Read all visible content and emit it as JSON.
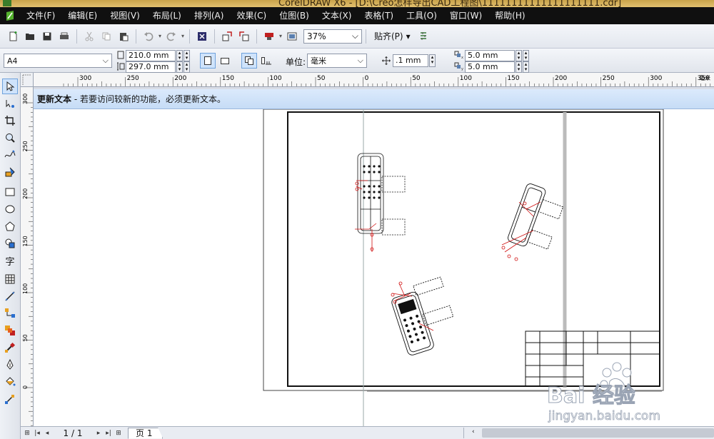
{
  "window": {
    "title": "CorelDRAW X6 - [D:\\Creo怎样导出CAD工程图\\11111111111111111111.cdr]"
  },
  "menu": [
    {
      "label": "文件(F)"
    },
    {
      "label": "编辑(E)"
    },
    {
      "label": "视图(V)"
    },
    {
      "label": "布局(L)"
    },
    {
      "label": "排列(A)"
    },
    {
      "label": "效果(C)"
    },
    {
      "label": "位图(B)"
    },
    {
      "label": "文本(X)"
    },
    {
      "label": "表格(T)"
    },
    {
      "label": "工具(O)"
    },
    {
      "label": "窗口(W)"
    },
    {
      "label": "帮助(H)"
    }
  ],
  "toolbar": {
    "zoom_value": "37%",
    "snap_label": "贴齐(P)"
  },
  "propbar": {
    "page_size": "A4",
    "width": "210.0 mm",
    "height": "297.0 mm",
    "units_label": "单位:",
    "units_value": "毫米",
    "nudge": ".1 mm",
    "dup_x": "5.0 mm",
    "dup_y": "5.0 mm"
  },
  "ruler": {
    "h_ticks": [
      "300",
      "250",
      "200",
      "150",
      "100",
      "50",
      "0",
      "50",
      "100",
      "150",
      "200",
      "250",
      "300",
      "350"
    ],
    "v_ticks": [
      "300",
      "250",
      "200",
      "150",
      "100",
      "50",
      "0"
    ],
    "unit": "毫米"
  },
  "notification": {
    "title": "更新文本",
    "message": " - 若要访问较新的功能，必须更新文本。"
  },
  "tools": [
    {
      "name": "pick"
    },
    {
      "name": "shape"
    },
    {
      "name": "crop"
    },
    {
      "name": "zoom"
    },
    {
      "name": "freehand"
    },
    {
      "name": "smart-fill"
    },
    {
      "name": "rectangle"
    },
    {
      "name": "ellipse"
    },
    {
      "name": "polygon"
    },
    {
      "name": "basic-shapes"
    },
    {
      "name": "text",
      "glyph": "字"
    },
    {
      "name": "table"
    },
    {
      "name": "dimension"
    },
    {
      "name": "connector"
    },
    {
      "name": "blend"
    },
    {
      "name": "eyedropper"
    },
    {
      "name": "outline"
    },
    {
      "name": "fill"
    },
    {
      "name": "interactive-fill"
    }
  ],
  "statusbar": {
    "page_counter": "1 / 1",
    "page_tab": "页 1"
  },
  "drawing": {
    "title_block_cols": 7,
    "title_block_rows": 5
  },
  "colors": {
    "menubar_bg": "#101010",
    "canvas_bg": "#ffffff",
    "accent_blue": "#cfe3fb",
    "annotation_red": "#d01010"
  },
  "watermark": {
    "line1": "Bai 经验",
    "line2": "jingyan.baidu.com"
  }
}
